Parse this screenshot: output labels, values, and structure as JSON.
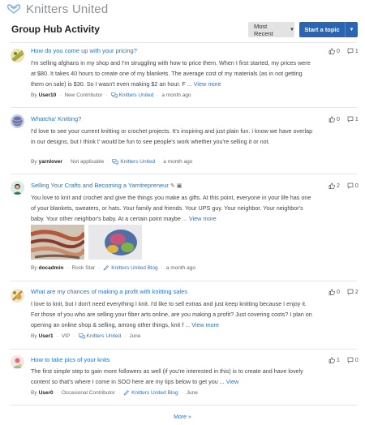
{
  "brand": {
    "name": "Knitters United"
  },
  "page": {
    "title": "Group Hub Activity"
  },
  "toolbar": {
    "sort_label": "Most Recent",
    "start_topic_label": "Start a topic"
  },
  "posts": [
    {
      "title": "How do you come up with your pricing?",
      "excerpt": "I'm selling afghans in my shop and I'm struggling with how to price them. When I first started, my prices were at $80. It takes 40 hours to create one of my blankets.  The average cost of my materials (as in not getting them on sale) is $30. So I wasn't even making $2 an hour. F",
      "view_more": "View more",
      "by": "By",
      "user": "User10",
      "rank": "New Contributor",
      "board": "Knitters United",
      "time": "a month ago",
      "likes": "0",
      "replies": "1"
    },
    {
      "title": "Whatcha' Knitting?",
      "excerpt": "I'd love to see your current knitting or crochet projects. It's inspiring and just plain fun. i know we have overlap in our designs, but I think t' would be fun to see people's work whether you're selling it or not.",
      "view_more": "",
      "by": "By",
      "user": "yarnlover",
      "rank": "Not applicable",
      "board": "Knitters United",
      "time": "a month ago",
      "likes": "0",
      "replies": "1"
    },
    {
      "title": "Selling Your Crafts and Becoming a Yarntrepreneur",
      "excerpt": "You love to knit and crochet and give the things you make as gifts. At this point, everyone in your life has one of your blankets, sweaters, or hats. Your family and friends. Your UPS guy. Your neighbor. Your neighbor's baby. Your other neighbor's baby. At a certain point maybe",
      "view_more": "View more",
      "by": "By",
      "user": "docadmin",
      "rank": "Rock Star",
      "board": "Knitters United Blog",
      "time": "a month ago",
      "likes": "2",
      "replies": "0"
    },
    {
      "title": "What are my chances of making a profit with knitting sales",
      "excerpt": "I love to knit, but I don't need everything I knit. I'd like to sell extras and just keep knitting because I enjoy it. For those of you who are selling your fiber arts online, are you making a profit? Just covering costs?   I plan on opening an online shop & selling, among other things, knit f",
      "view_more": "View more",
      "by": "By",
      "user": "User1",
      "rank": "VIP",
      "board": "Knitters United",
      "time": "June",
      "likes": "0",
      "replies": "2"
    },
    {
      "title": "How to take pics of your knits",
      "excerpt": "The first simple step to gain more followers as well (if you're interested in this) is to create and have lovely content so that's where I come in SOO here are my tips below to get you ...",
      "view_more": "View",
      "by": "By",
      "user": "User0",
      "rank": "Occasional Contributor",
      "board": "Knitters United Blog",
      "time": "June",
      "likes": "1",
      "replies": "0"
    }
  ],
  "footer": {
    "more_label": "More »"
  },
  "colors": {
    "accent": "#2a65b4",
    "link": "#2a73c7"
  },
  "icons": [
    "knitters-logo-icon",
    "thumbs-up-icon",
    "comment-icon",
    "board-icon",
    "blog-icon",
    "image-icon",
    "caret-down-icon"
  ]
}
